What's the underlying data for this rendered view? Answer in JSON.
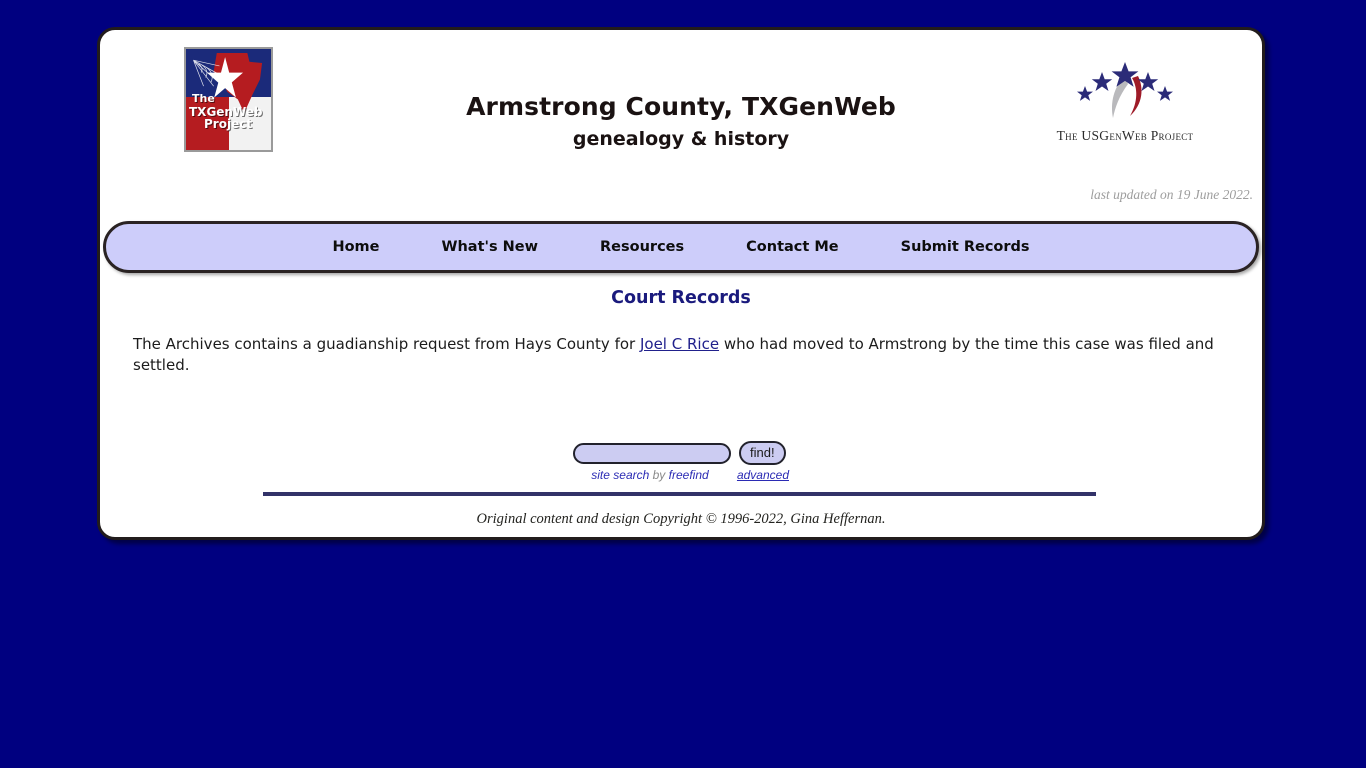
{
  "site": {
    "title": "Armstrong County, TXGenWeb",
    "subtitle": "genealogy & history",
    "last_updated": "last updated on 19 June 2022.",
    "background_color": "#000080",
    "nav_fill_color": "#cdcdfa",
    "heading_color": "#1a1a7d",
    "link_color": "#21218c"
  },
  "txgenweb_logo": {
    "line1": "The",
    "line2": "TXGenWeb",
    "line3": "Project",
    "alt": "The TXGenWeb Project"
  },
  "usgenweb_logo": {
    "caption": "The USGenWeb Project",
    "star_count": 5,
    "star_color": "#2b2b78",
    "swoosh_red": "#9e1b28",
    "swoosh_gray": "#b9b9bc"
  },
  "nav": {
    "items": [
      {
        "label": "Home"
      },
      {
        "label": "What's New"
      },
      {
        "label": "Resources"
      },
      {
        "label": "Contact Me"
      },
      {
        "label": "Submit Records"
      }
    ]
  },
  "main": {
    "heading": "Court Records",
    "paragraph": {
      "before_link": "The Archives contains a guadianship request from Hays County for ",
      "link_text": "Joel C Rice",
      "after_link": " who had moved to Armstrong by the time this case was filed and settled."
    }
  },
  "search": {
    "input_value": "",
    "placeholder": "",
    "find_label": "find!",
    "credit_lead": "site search",
    "credit_by": " by ",
    "credit_brand": "freefind",
    "advanced_label": "advanced"
  },
  "footer": {
    "copyright": "Original content and design Copyright © 1996-2022, Gina Heffernan."
  }
}
